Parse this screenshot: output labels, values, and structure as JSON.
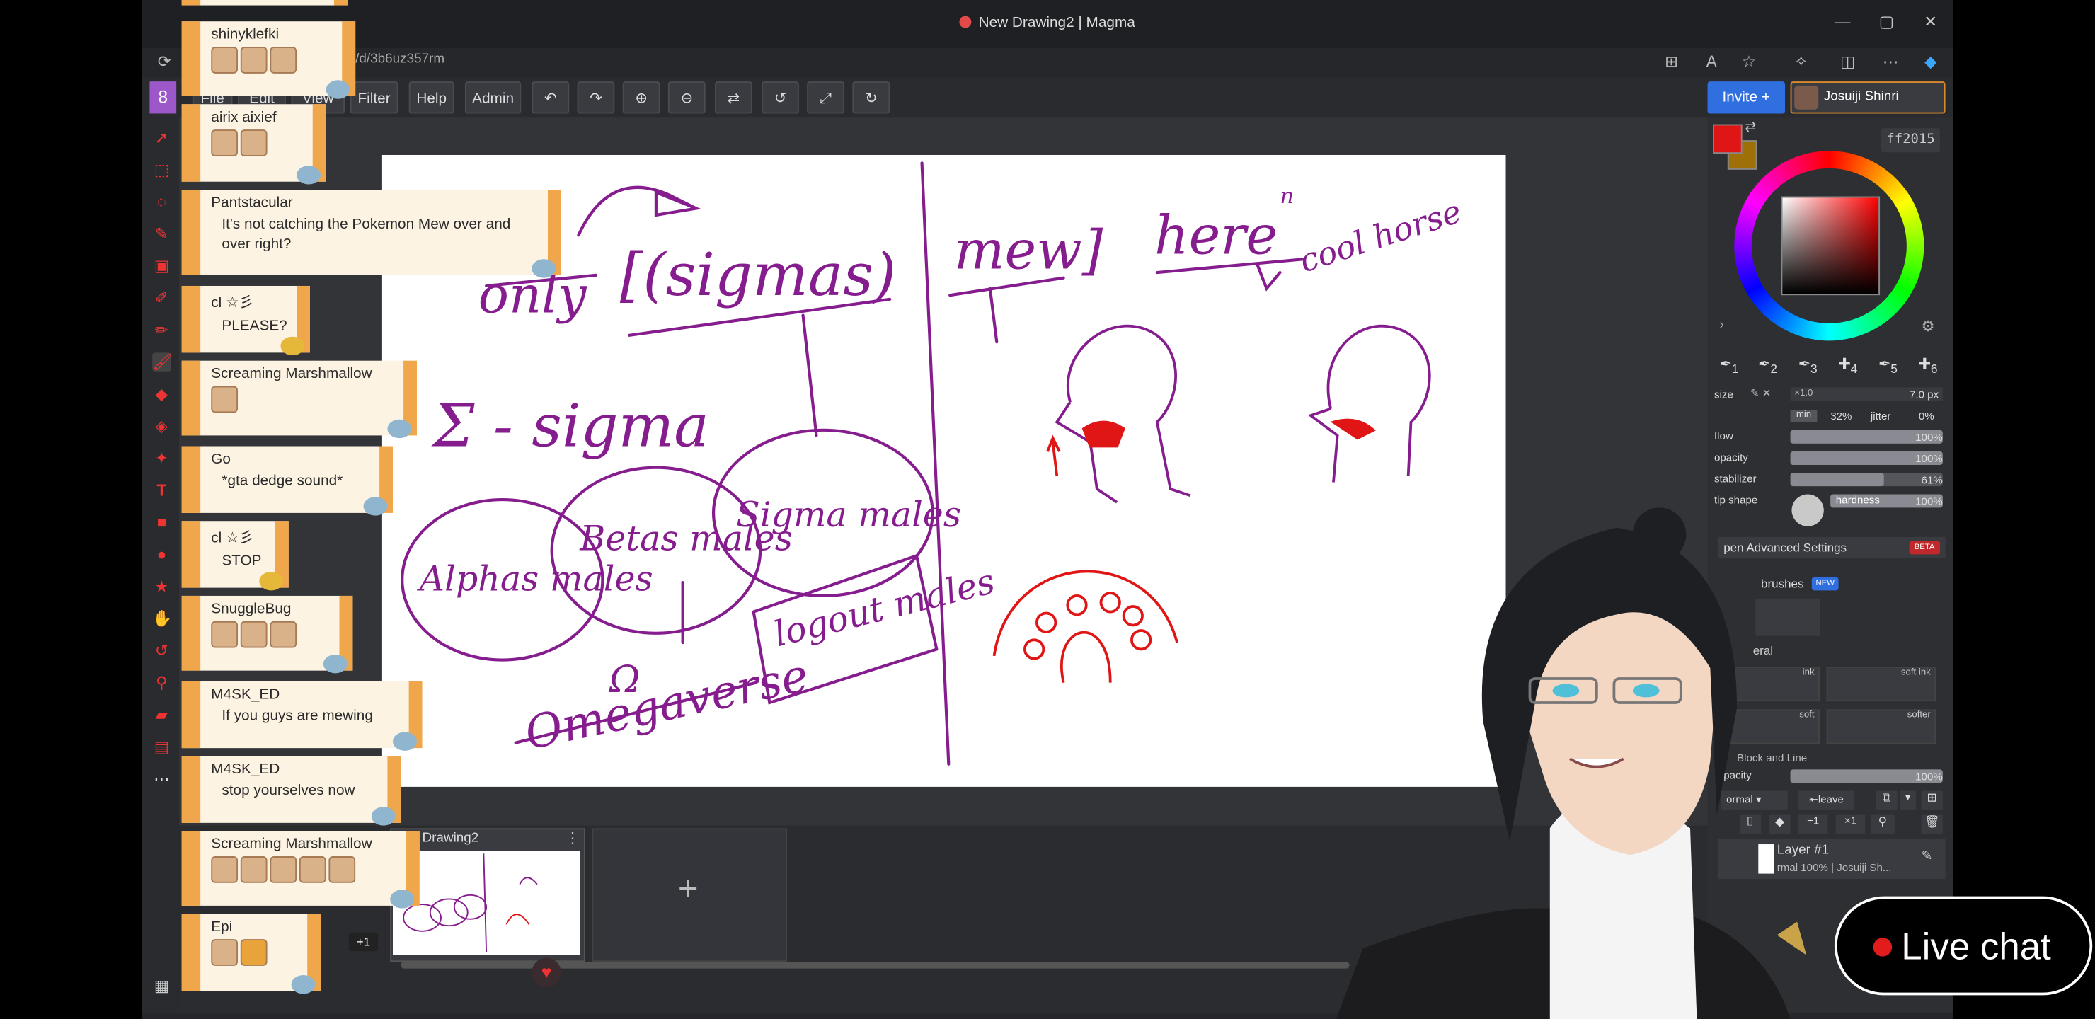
{
  "window": {
    "title": "New Drawing2 | Magma",
    "url": "/d/3b6uz357rm",
    "controls": [
      "—",
      "▢",
      "✕"
    ]
  },
  "toolbar": {
    "menus": [
      "File",
      "Edit",
      "View",
      "Filter",
      "Help",
      "Admin"
    ],
    "icons": [
      "undo-icon",
      "redo-icon",
      "zoom-in-icon",
      "zoom-out-icon",
      "flip-icon",
      "rotate-icon",
      "fullscreen-icon",
      "refresh-icon"
    ]
  },
  "header": {
    "invite_label": "Invite",
    "user_name": "Josuiji Shinri",
    "online_count": "8"
  },
  "drawing": {
    "texts": {
      "only": "only",
      "sigmas": "[(sigmas)",
      "mew": "mew]",
      "here": "here",
      "n": "n",
      "cool_horse": "cool horse",
      "sigma_line": "Σ - sigma",
      "alphas": "Alphas males",
      "betas": "Betas males",
      "sigma_males": "Sigma males",
      "logout": "logout males",
      "omega_sym": "Ω",
      "omegaverse": "Omegaverse"
    }
  },
  "thumbnails": {
    "drawing_name": "Drawing2",
    "extra_count": "+1",
    "add_label": "+"
  },
  "color": {
    "primary": "#e01515",
    "secondary": "#a07008",
    "hex": "ff2015"
  },
  "brush": {
    "slots": [
      "1",
      "2",
      "3",
      "4",
      "5",
      "6"
    ],
    "size_label": "size",
    "size_mult": "×1.0",
    "size_value": "7.0 px",
    "min_label": "min",
    "min_value": "32%",
    "jitter_label": "jitter",
    "jitter_value": "0%",
    "flow_label": "flow",
    "flow_value": "100%",
    "flow_level": 1.0,
    "opacity_label": "opacity",
    "opacity_value": "100%",
    "opacity_level": 1.0,
    "stabilizer_label": "stabilizer",
    "stabilizer_value": "61%",
    "stabilizer_level": 0.61,
    "tip_shape_label": "tip shape",
    "hardness_label": "hardness",
    "hardness_value": "100%",
    "hardness_level": 1.0
  },
  "advanced": {
    "label": "pen Advanced Settings",
    "beta": "BETA"
  },
  "brushes": {
    "label": "brushes",
    "new_badge": "NEW",
    "group": "eral",
    "presets": [
      "ink",
      "soft ink",
      "soft",
      "softer"
    ],
    "group2": "Block and Line"
  },
  "layers": {
    "opacity_label": "pacity",
    "opacity_value": "100%",
    "blend_mode": "ormal",
    "leave_label": "leave",
    "layer_name": "Layer #1",
    "layer_sub": "rmal 100% | Josuiji Sh..."
  },
  "chat": [
    {
      "name": "shinyklefki",
      "emotes": 3
    },
    {
      "name": "airix aixief",
      "emotes": 2
    },
    {
      "name": "Pantstacular",
      "message": "It's not catching the Pokemon Mew over and over right?"
    },
    {
      "name": "cl ☆彡",
      "message": "PLEASE?"
    },
    {
      "name": "Screaming Marshmallow",
      "emotes": 1
    },
    {
      "name": "Go",
      "message": "*gta dedge sound*"
    },
    {
      "name": "cl ☆彡",
      "message": "STOP"
    },
    {
      "name": "SnuggleBug",
      "emotes": 3
    },
    {
      "name": "M4SK_ED",
      "message": "If you guys are mewing"
    },
    {
      "name": "M4SK_ED",
      "message": "stop yourselves now"
    },
    {
      "name": "Screaming Marshmallow",
      "emotes": 5
    },
    {
      "name": "Epi",
      "emotes": 2
    }
  ],
  "live_chat": {
    "label": "Live chat"
  }
}
